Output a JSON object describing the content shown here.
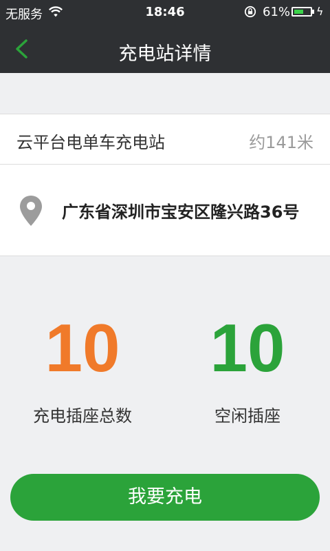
{
  "status_bar": {
    "carrier": "无服务",
    "time": "18:46",
    "battery_percent": "61%",
    "battery_level": 0.61,
    "battery_color": "#3bd24a"
  },
  "nav": {
    "title": "充电站详情",
    "back_icon": "chevron-left-icon",
    "accent": "#2ba33a"
  },
  "station": {
    "name": "云平台电单车充电站",
    "distance": "约141米"
  },
  "address": {
    "icon": "location-pin-icon",
    "text": "广东省深圳市宝安区隆兴路36号"
  },
  "stats": {
    "total": {
      "value": "10",
      "label": "充电插座总数",
      "color": "#f07a2a"
    },
    "free": {
      "value": "10",
      "label": "空闲插座",
      "color": "#2ba33a"
    }
  },
  "action": {
    "charge_label": "我要充电",
    "color": "#2ba33a"
  }
}
